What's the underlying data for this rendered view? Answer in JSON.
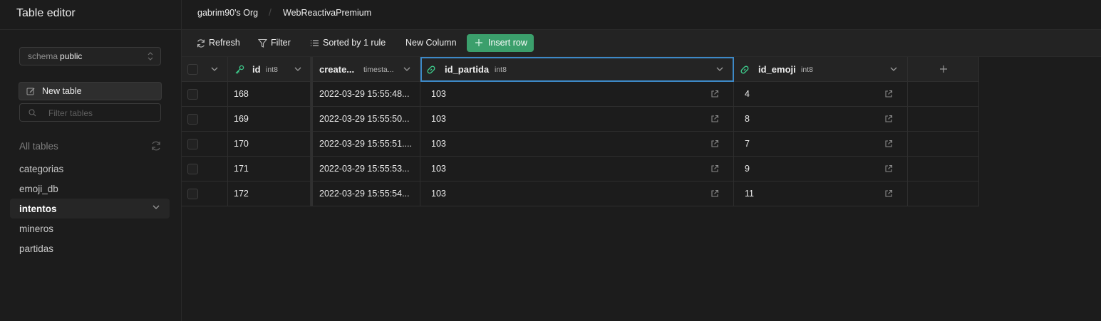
{
  "sidebar": {
    "title": "Table editor",
    "schema_label": "schema",
    "schema_value": "public",
    "new_table_label": "New table",
    "filter_placeholder": "Filter tables",
    "all_tables_label": "All tables",
    "tables": [
      {
        "name": "categorias",
        "active": false
      },
      {
        "name": "emoji_db",
        "active": false
      },
      {
        "name": "intentos",
        "active": true
      },
      {
        "name": "mineros",
        "active": false
      },
      {
        "name": "partidas",
        "active": false
      }
    ]
  },
  "breadcrumb": {
    "org": "gabrim90's Org",
    "separator": "/",
    "project": "WebReactivaPremium"
  },
  "toolbar": {
    "refresh_label": "Refresh",
    "filter_label": "Filter",
    "sort_label": "Sorted by 1 rule",
    "new_column_label": "New Column",
    "insert_row_label": "Insert row"
  },
  "table": {
    "columns": [
      {
        "name": "id",
        "type": "int8",
        "icon": "key-icon"
      },
      {
        "name": "create...",
        "type": "timesta...",
        "icon": ""
      },
      {
        "name": "id_partida",
        "type": "int8",
        "icon": "link-icon"
      },
      {
        "name": "id_emoji",
        "type": "int8",
        "icon": "link-icon"
      }
    ],
    "add_column_icon": "plus-icon",
    "rows": [
      {
        "id": "168",
        "created": "2022-03-29 15:55:48...",
        "id_partida": "103",
        "id_emoji": "4"
      },
      {
        "id": "169",
        "created": "2022-03-29 15:55:50...",
        "id_partida": "103",
        "id_emoji": "8"
      },
      {
        "id": "170",
        "created": "2022-03-29 15:55:51....",
        "id_partida": "103",
        "id_emoji": "7"
      },
      {
        "id": "171",
        "created": "2022-03-29 15:55:53...",
        "id_partida": "103",
        "id_emoji": "9"
      },
      {
        "id": "172",
        "created": "2022-03-29 15:55:54...",
        "id_partida": "103",
        "id_emoji": "11"
      }
    ]
  },
  "colors": {
    "accent_green": "#3b9f6c",
    "selection_blue": "#3d89c7",
    "link_green": "#3ecf8e"
  }
}
